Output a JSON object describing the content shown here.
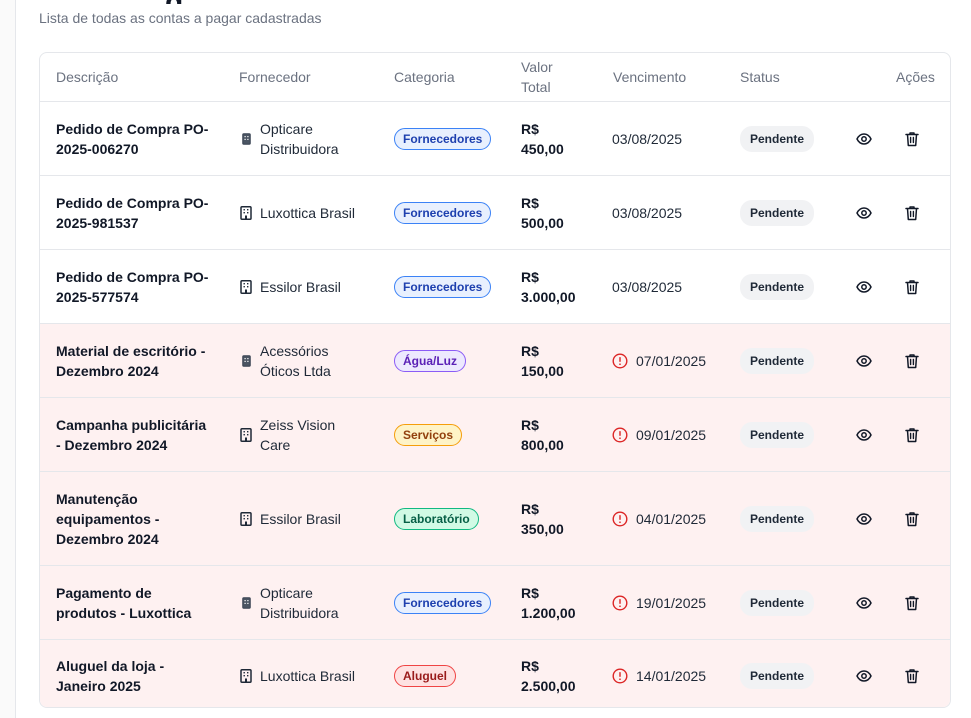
{
  "page": {
    "title_fragment": "g",
    "subtitle": "Lista de todas as contas a pagar cadastradas"
  },
  "table": {
    "headers": {
      "descricao": "Descrição",
      "fornecedor": "Fornecedor",
      "categoria": "Categoria",
      "valor_line1": "Valor",
      "valor_line2": "Total",
      "vencimento": "Vencimento",
      "status": "Status",
      "acoes": "Ações"
    },
    "rows": [
      {
        "desc_l1": "Pedido de Compra PO-",
        "desc_l2": "2025-006270",
        "desc_l3": "",
        "sup_l1": "Opticare",
        "sup_l2": "Distribuidora",
        "sup_icon": "small-building-icon",
        "category": "Fornecedores",
        "cat_color": "blue",
        "value_l1": "R$",
        "value_l2": "450,00",
        "due": "03/08/2025",
        "overdue": false,
        "status": "Pendente"
      },
      {
        "desc_l1": "Pedido de Compra PO-",
        "desc_l2": "2025-981537",
        "desc_l3": "",
        "sup_l1": "Luxottica Brasil",
        "sup_l2": "",
        "sup_icon": "building-icon",
        "category": "Fornecedores",
        "cat_color": "blue",
        "value_l1": "R$",
        "value_l2": "500,00",
        "due": "03/08/2025",
        "overdue": false,
        "status": "Pendente"
      },
      {
        "desc_l1": "Pedido de Compra PO-",
        "desc_l2": "2025-577574",
        "desc_l3": "",
        "sup_l1": "Essilor Brasil",
        "sup_l2": "",
        "sup_icon": "building-icon",
        "category": "Fornecedores",
        "cat_color": "blue",
        "value_l1": "R$",
        "value_l2": "3.000,00",
        "due": "03/08/2025",
        "overdue": false,
        "status": "Pendente"
      },
      {
        "desc_l1": "Material de escritório -",
        "desc_l2": "Dezembro 2024",
        "desc_l3": "",
        "sup_l1": "Acessórios",
        "sup_l2": "Óticos Ltda",
        "sup_icon": "small-building-icon",
        "category": "Água/Luz",
        "cat_color": "purple",
        "value_l1": "R$",
        "value_l2": "150,00",
        "due": "07/01/2025",
        "overdue": true,
        "status": "Pendente"
      },
      {
        "desc_l1": "Campanha publicitária",
        "desc_l2": "- Dezembro 2024",
        "desc_l3": "",
        "sup_l1": "Zeiss Vision",
        "sup_l2": "Care",
        "sup_icon": "building-icon",
        "category": "Serviços",
        "cat_color": "orange",
        "value_l1": "R$",
        "value_l2": "800,00",
        "due": "09/01/2025",
        "overdue": true,
        "status": "Pendente"
      },
      {
        "desc_l1": "Manutenção",
        "desc_l2": "equipamentos -",
        "desc_l3": "Dezembro 2024",
        "sup_l1": "Essilor Brasil",
        "sup_l2": "",
        "sup_icon": "building-icon",
        "category": "Laboratório",
        "cat_color": "green",
        "value_l1": "R$",
        "value_l2": "350,00",
        "due": "04/01/2025",
        "overdue": true,
        "status": "Pendente"
      },
      {
        "desc_l1": "Pagamento de",
        "desc_l2": "produtos - Luxottica",
        "desc_l3": "",
        "sup_l1": "Opticare",
        "sup_l2": "Distribuidora",
        "sup_icon": "small-building-icon",
        "category": "Fornecedores",
        "cat_color": "blue",
        "value_l1": "R$",
        "value_l2": "1.200,00",
        "due": "19/01/2025",
        "overdue": true,
        "status": "Pendente"
      },
      {
        "desc_l1": "Aluguel da loja -",
        "desc_l2": "Janeiro 2025",
        "desc_l3": "",
        "sup_l1": "Luxottica Brasil",
        "sup_l2": "",
        "sup_icon": "building-icon",
        "category": "Aluguel",
        "cat_color": "red",
        "value_l1": "R$",
        "value_l2": "2.500,00",
        "due": "14/01/2025",
        "overdue": true,
        "status": "Pendente"
      }
    ]
  },
  "colors": {
    "overdue_row_bg": "#fef1f1",
    "alert_icon": "#dc2626",
    "badge_blue": "#1e40af",
    "badge_purple": "#5b21b6",
    "badge_orange": "#92400e",
    "badge_green": "#065f46",
    "badge_red": "#991b1b"
  }
}
